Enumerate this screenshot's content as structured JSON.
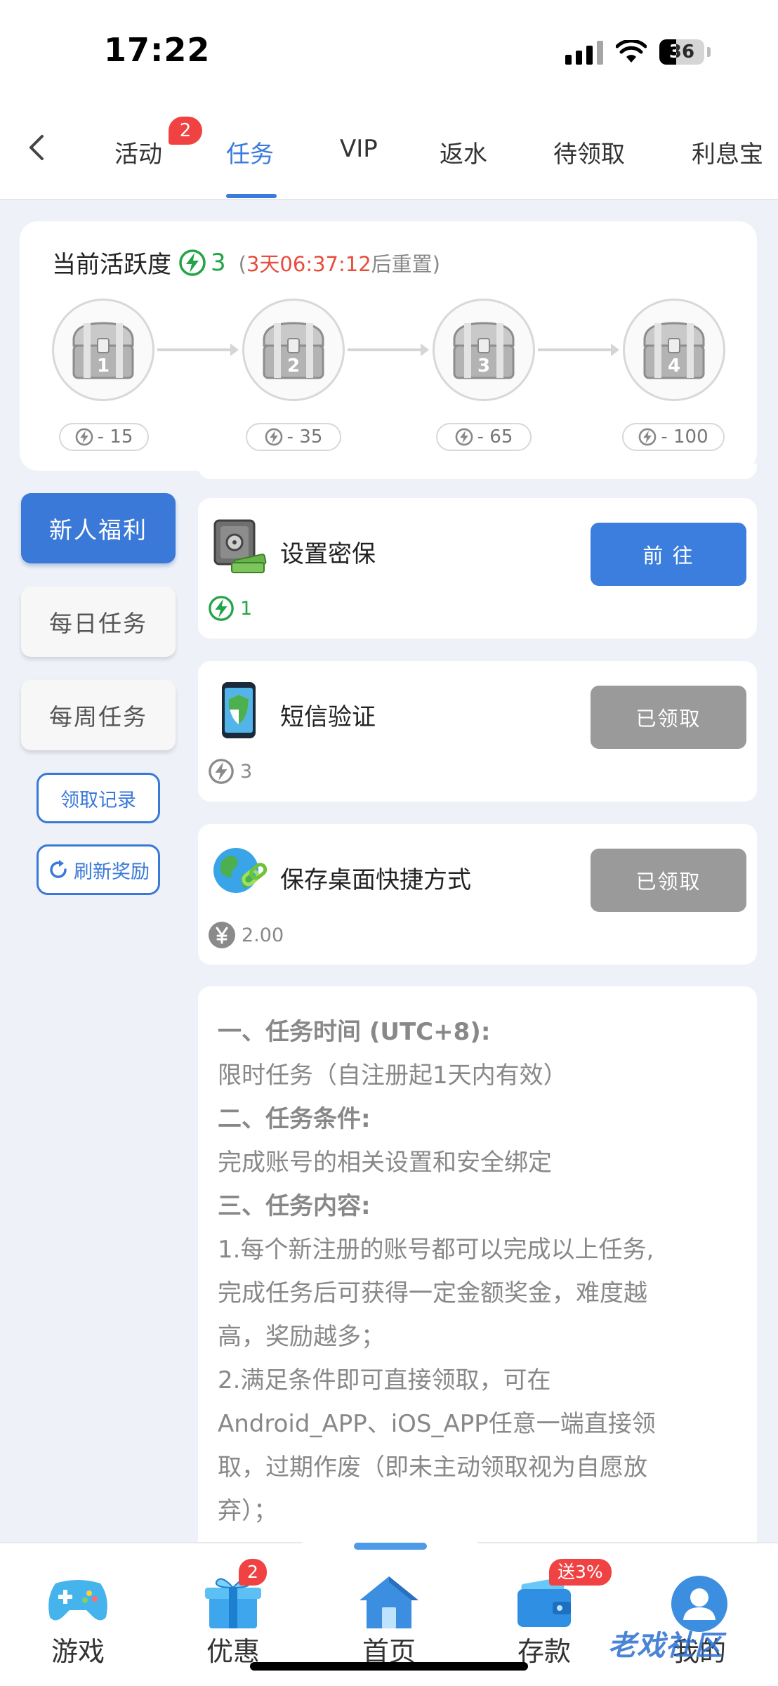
{
  "status_bar": {
    "time": "17:22",
    "battery": "36"
  },
  "tabs": [
    {
      "label": "活动",
      "badge": "2"
    },
    {
      "label": "任务",
      "active": true
    },
    {
      "label": "VIP"
    },
    {
      "label": "返水"
    },
    {
      "label": "待领取"
    },
    {
      "label": "利息宝"
    }
  ],
  "activity": {
    "title": "当前活跃度",
    "value": "3",
    "reset_open": "(",
    "reset_time": "3天06:37:12",
    "reset_suffix": "后重置)",
    "chests": [
      {
        "num": "1",
        "cost": "- 15"
      },
      {
        "num": "2",
        "cost": "- 35"
      },
      {
        "num": "3",
        "cost": "- 65"
      },
      {
        "num": "4",
        "cost": "- 100"
      }
    ]
  },
  "menu": {
    "newbie": "新人福利",
    "daily": "每日任务",
    "weekly": "每周任务",
    "records": "领取记录",
    "refresh": "刷新奖励"
  },
  "tasks": [
    {
      "name": "设置密保",
      "button": "前 往",
      "reward": "1",
      "icon": "safe-icon",
      "state": "go"
    },
    {
      "name": "短信验证",
      "button": "已领取",
      "reward": "3",
      "icon": "phone-shield-icon",
      "state": "done"
    },
    {
      "name": "保存桌面快捷方式",
      "button": "已领取",
      "reward": "2.00",
      "icon": "globe-link-icon",
      "state": "done"
    }
  ],
  "description": {
    "lines": [
      "一、任务时间 (UTC+8):",
      "限时任务（自注册起1天内有效）",
      "二、任务条件:",
      "完成账号的相关设置和安全绑定",
      "三、任务内容:",
      "1.每个新注册的账号都可以完成以上任务,",
      "完成任务后可获得一定金额奖金，难度越",
      "高，奖励越多；",
      "2.满足条件即可直接领取，可在",
      "Android_APP、iOS_APP任意一端直接领",
      "取，过期作废（即未主动领取视为自愿放",
      "弃）；"
    ]
  },
  "bottom_nav": {
    "items": [
      {
        "label": "游戏",
        "icon": "gamepad-icon"
      },
      {
        "label": "优惠",
        "icon": "gift-icon",
        "badge": "2"
      },
      {
        "label": "首页",
        "icon": "home-icon"
      },
      {
        "label": "存款",
        "icon": "wallet-icon",
        "badge": "送3%"
      },
      {
        "label": "我的",
        "icon": "avatar-icon"
      }
    ],
    "watermark": "老戏社区"
  },
  "colors": {
    "accent": "#3a7bdc",
    "green": "#22a447",
    "red": "#e84d3c",
    "disabled": "#9a9a9a"
  }
}
